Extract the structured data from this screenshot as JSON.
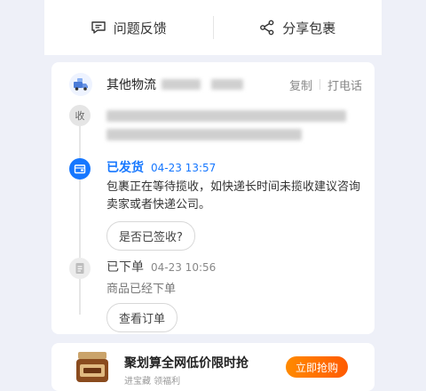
{
  "topbar": {
    "feedback_label": "问题反馈",
    "share_label": "分享包裹"
  },
  "logistics": {
    "carrier_name": "其他物流",
    "copy_label": "复制",
    "call_label": "打电话",
    "receive_node_label": "收"
  },
  "events": [
    {
      "title": "已发货",
      "time": "04-23 13:57",
      "desc": "包裹正在等待揽收，如快递长时间未揽收建议咨询卖家或者快递公司。",
      "button": "是否已签收?"
    },
    {
      "title": "已下单",
      "time": "04-23 10:56",
      "desc": "商品已经下单",
      "button": "查看订单"
    }
  ],
  "promo": {
    "title": "聚划算全网低价限时抢",
    "subtitle": "进宝藏 领福利",
    "button": "立即抢购"
  },
  "colors": {
    "accent": "#1677ff",
    "promo_button": "#ff6a00",
    "background": "#eef0f8"
  }
}
